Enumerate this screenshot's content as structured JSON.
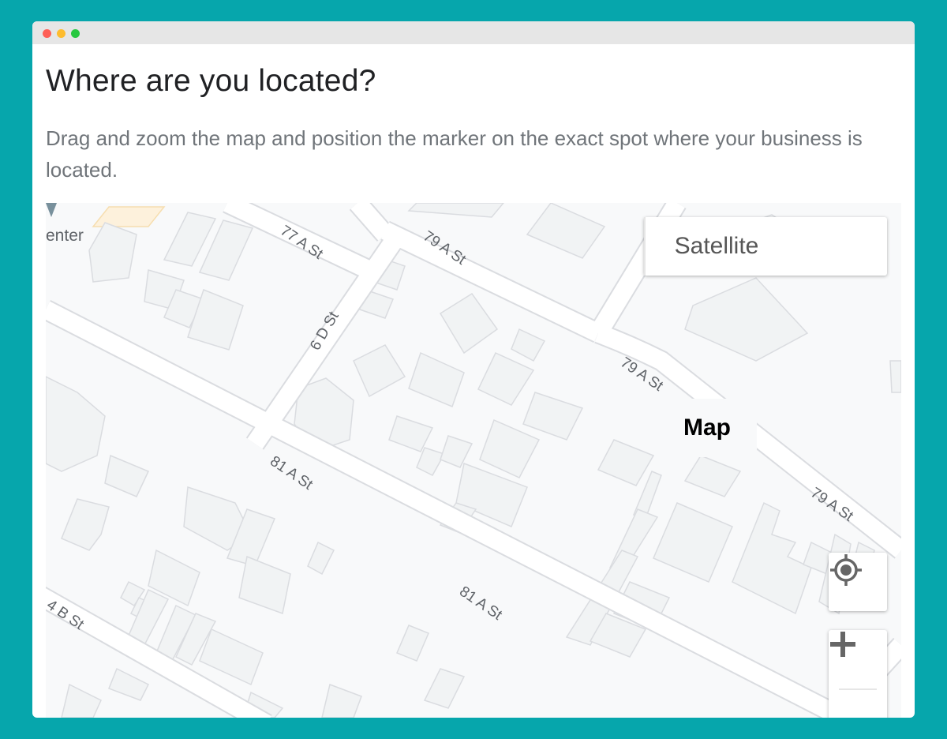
{
  "page": {
    "title": "Where are you located?",
    "description": "Drag and zoom the map and position the marker on the exact spot where your business is located."
  },
  "map": {
    "poi_label": "enter",
    "streets": {
      "s77a": "77 A St",
      "s79a_1": "79 A St",
      "s79a_2": "79 A St",
      "s79a_3": "79 A St",
      "s6d": "6 D St",
      "s81a_1": "81 A St",
      "s81a_2": "81 A St",
      "s4b": "4 B St"
    },
    "type_control": {
      "map_label": "Map",
      "satellite_label": "Satellite",
      "selected": "Map"
    },
    "controls": {
      "locate_icon": "my-location-icon",
      "zoom_in_icon": "plus-icon",
      "zoom_out_icon": "minus-icon"
    }
  },
  "colors": {
    "background": "#06a6ac",
    "map_land": "#f8f9fa",
    "building": "#f1f3f4",
    "road": "#ffffff"
  }
}
